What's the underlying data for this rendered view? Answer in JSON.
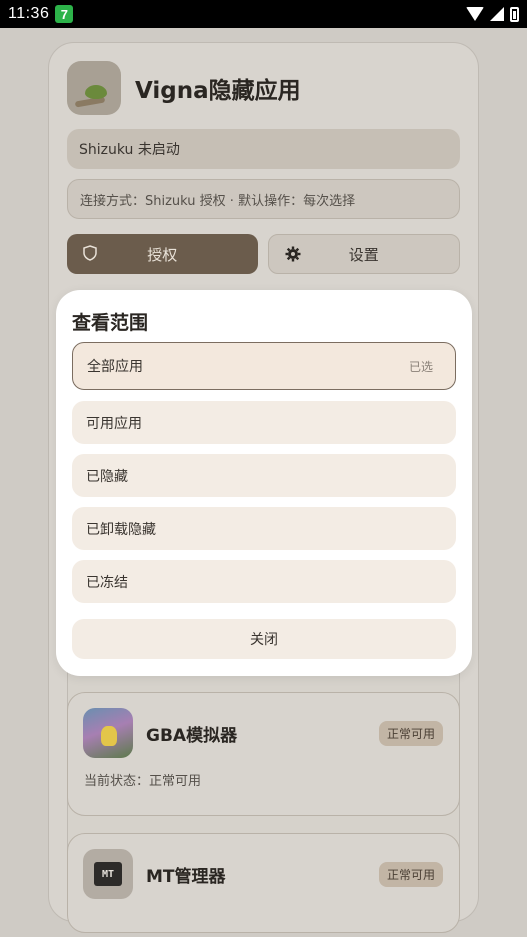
{
  "status_bar": {
    "time": "11:36",
    "notification_badge": "7"
  },
  "app": {
    "title": "Vigna隐藏应用",
    "shizuku_status": "Shizuku 未启动",
    "connection_info": "连接方式：Shizuku 授权 · 默认操作：每次选择",
    "authorize_label": "授权",
    "settings_label": "设置"
  },
  "apps": [
    {
      "name": "GBA模拟器",
      "badge": "正常可用",
      "state": "当前状态：正常可用"
    },
    {
      "name": "MT管理器",
      "badge": "正常可用",
      "icon_text": "MT"
    }
  ],
  "dialog": {
    "title": "查看范围",
    "selected_tag": "已选",
    "options": [
      "全部应用",
      "可用应用",
      "已隐藏",
      "已卸载隐藏",
      "已冻结"
    ],
    "close_label": "关闭"
  },
  "colors": {
    "primary_button": "#6b5c4c",
    "option_bg": "#f3ece4",
    "selected_border": "#7b6d60"
  }
}
